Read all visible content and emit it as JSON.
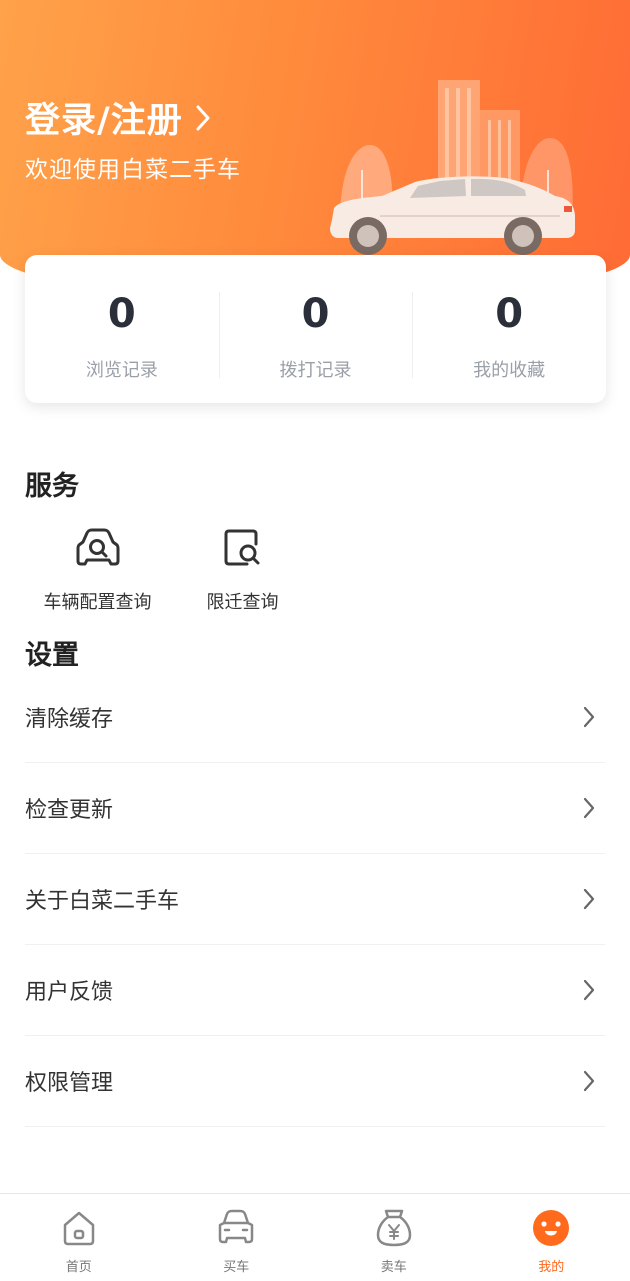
{
  "header": {
    "login_label": "登录/注册",
    "welcome_text": "欢迎使用白菜二手车",
    "gradient_colors": [
      "#ffa24a",
      "#ff6b35"
    ]
  },
  "stats": [
    {
      "value": "0",
      "label": "浏览记录"
    },
    {
      "value": "0",
      "label": "拨打记录"
    },
    {
      "value": "0",
      "label": "我的收藏"
    }
  ],
  "services": {
    "title": "服务",
    "items": [
      {
        "label": "车辆配置查询",
        "icon": "car-search-icon"
      },
      {
        "label": "限迁查询",
        "icon": "document-search-icon"
      }
    ]
  },
  "settings": {
    "title": "设置",
    "items": [
      {
        "label": "清除缓存"
      },
      {
        "label": "检查更新"
      },
      {
        "label": "关于白菜二手车"
      },
      {
        "label": "用户反馈"
      },
      {
        "label": "权限管理"
      }
    ]
  },
  "tabbar": {
    "active_color": "#ff6a1c",
    "items": [
      {
        "label": "首页",
        "icon": "home-icon"
      },
      {
        "label": "买车",
        "icon": "car-front-icon"
      },
      {
        "label": "卖车",
        "icon": "money-bag-icon"
      },
      {
        "label": "我的",
        "icon": "profile-face-icon"
      }
    ]
  }
}
